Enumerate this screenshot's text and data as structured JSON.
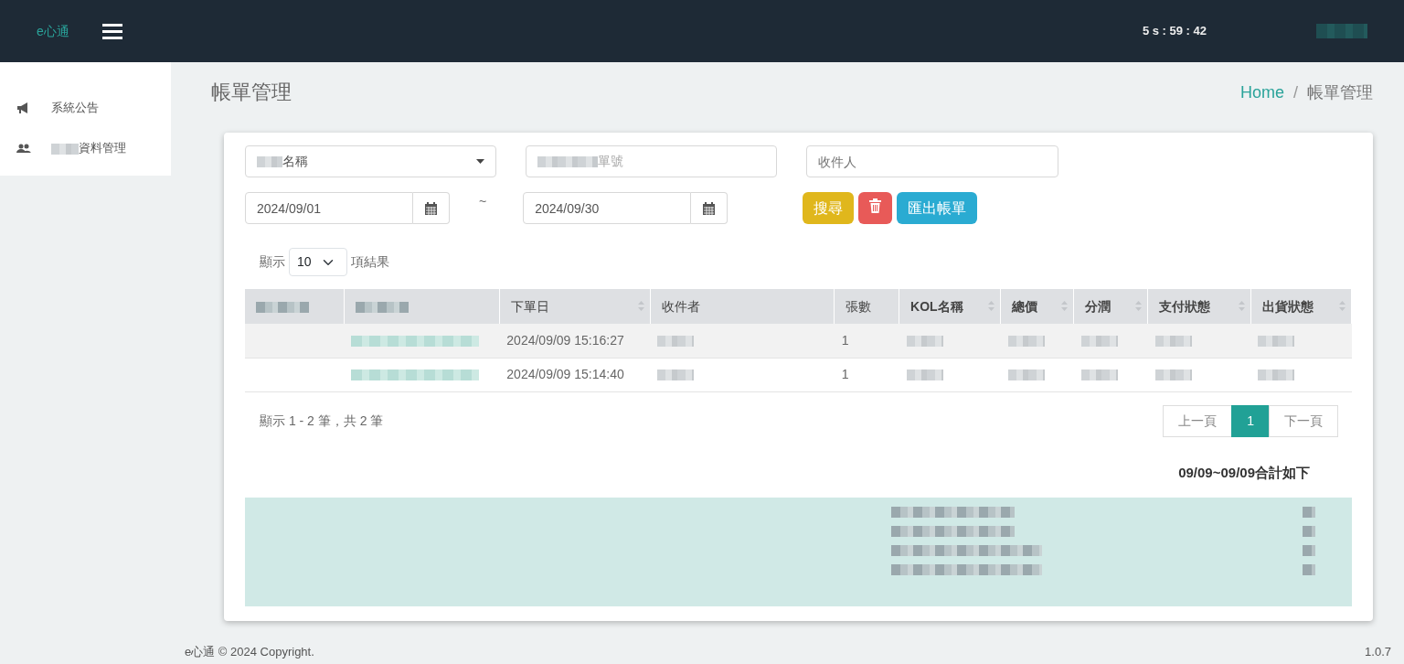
{
  "navbar": {
    "brand": "e心通",
    "timer": "5 s : 59  : 42",
    "user": {
      "kind": "blurred"
    }
  },
  "sidebar": {
    "items": [
      {
        "kind": "plain",
        "label": "系統公告"
      },
      {
        "kind": "blurred-prefix",
        "label": "資料管理"
      }
    ]
  },
  "page": {
    "title": "帳單管理",
    "breadcrumb": [
      {
        "label": "Home",
        "kind": "link"
      },
      {
        "label": "/",
        "kind": "separator"
      },
      {
        "label": "帳單管理",
        "kind": "current"
      }
    ]
  },
  "filters": {
    "select": {
      "value": "名稱",
      "kind": "blurred-prefix"
    },
    "order_no": {
      "placeholder": "單號",
      "kind": "blurred-prefix"
    },
    "recipient": {
      "placeholder": "收件人"
    },
    "date_from": "2024/09/01",
    "separator": "~",
    "date_to": "2024/09/30",
    "buttons": [
      {
        "kind": "search",
        "label": "搜尋"
      },
      {
        "kind": "delete"
      },
      {
        "kind": "export",
        "label": "匯出帳單"
      }
    ]
  },
  "length": {
    "before": "顯示",
    "value": "10",
    "after": "項結果"
  },
  "table": {
    "columns": [
      {
        "kind": "blurred",
        "sortable": false
      },
      {
        "kind": "blurred",
        "sortable": false
      },
      {
        "kind": "text",
        "label": "下單日",
        "sortable": true
      },
      {
        "kind": "text",
        "label": "收件者",
        "sortable": false
      },
      {
        "kind": "text",
        "label": "張數",
        "sortable": false
      },
      {
        "kind": "text",
        "label": "KOL名稱",
        "sortable": true
      },
      {
        "kind": "text",
        "label": "總價",
        "sortable": true
      },
      {
        "kind": "text",
        "label": "分潤",
        "sortable": true
      },
      {
        "kind": "text",
        "label": "支付狀態",
        "sortable": true
      },
      {
        "kind": "text",
        "label": "出貨狀態",
        "sortable": true
      }
    ],
    "rows": [
      {
        "cells": [
          {
            "kind": "empty"
          },
          {
            "kind": "blurred-link"
          },
          {
            "kind": "text",
            "text": "2024/09/09 15:16:27"
          },
          {
            "kind": "blurred"
          },
          {
            "kind": "text",
            "text": "1"
          },
          {
            "kind": "blurred"
          },
          {
            "kind": "blurred"
          },
          {
            "kind": "blurred"
          },
          {
            "kind": "blurred"
          },
          {
            "kind": "blurred"
          }
        ]
      },
      {
        "cells": [
          {
            "kind": "empty"
          },
          {
            "kind": "blurred-link"
          },
          {
            "kind": "text",
            "text": "2024/09/09 15:14:40"
          },
          {
            "kind": "blurred"
          },
          {
            "kind": "text",
            "text": "1"
          },
          {
            "kind": "blurred"
          },
          {
            "kind": "blurred"
          },
          {
            "kind": "blurred"
          },
          {
            "kind": "blurred"
          },
          {
            "kind": "blurred"
          }
        ]
      }
    ]
  },
  "info": "顯示 1 - 2 筆，共 2 筆",
  "pagination": [
    {
      "label": "上一頁",
      "selected": false
    },
    {
      "label": "1",
      "selected": true
    },
    {
      "label": "下一頁",
      "selected": false
    }
  ],
  "summary": {
    "title": "09/09~09/09合計如下",
    "lines": [
      {
        "kind": "blurred"
      },
      {
        "kind": "blurred"
      },
      {
        "kind": "blurred"
      },
      {
        "kind": "blurred"
      }
    ]
  },
  "footer": {
    "copyright": "e心通 © 2024 Copyright.",
    "version": "1.0.7"
  }
}
